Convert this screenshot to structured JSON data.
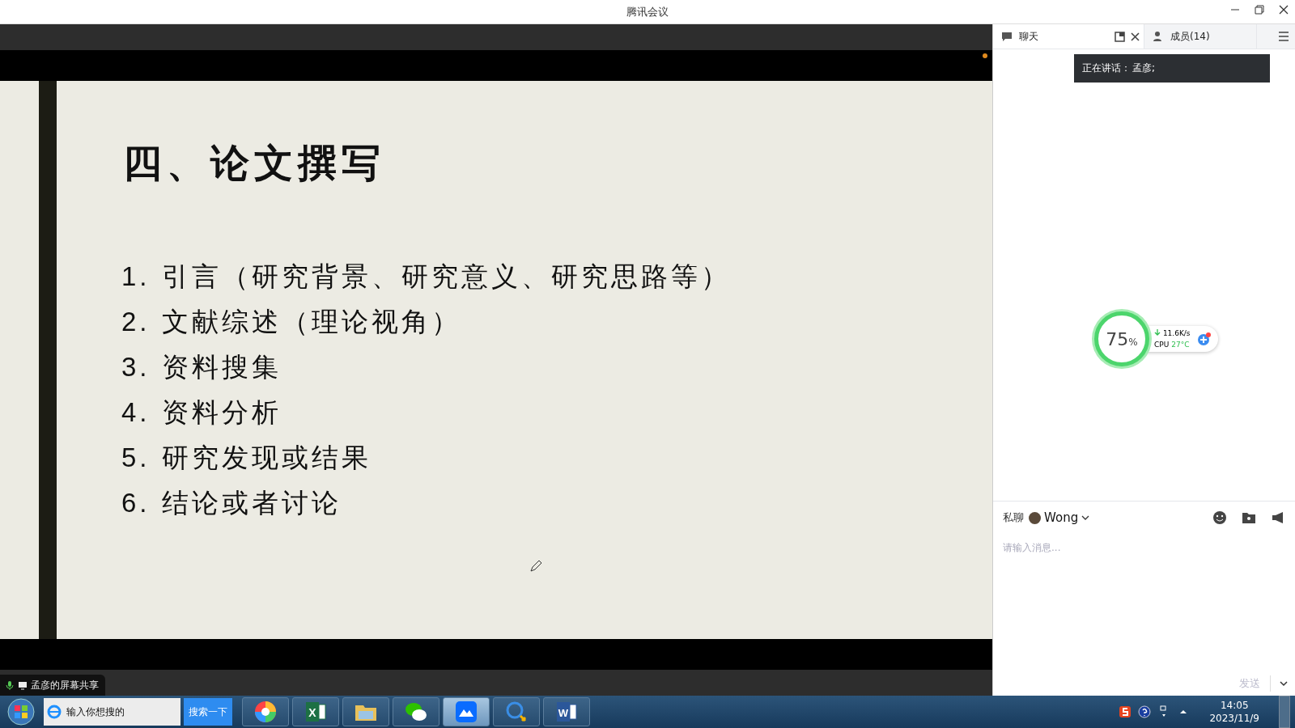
{
  "window": {
    "title": "腾讯会议"
  },
  "shared_screen": {
    "slide_title": "四、论文撰写",
    "items": [
      {
        "number": "1.",
        "text": "引言（研究背景、研究意义、研究思路等）"
      },
      {
        "number": "2.",
        "text": "文献综述（理论视角）"
      },
      {
        "number": "3.",
        "text": "资料搜集"
      },
      {
        "number": "4.",
        "text": "资料分析"
      },
      {
        "number": "5.",
        "text": "研究发现或结果"
      },
      {
        "number": "6.",
        "text": "结论或者讨论"
      }
    ],
    "share_label": "孟彦的屏幕共享"
  },
  "side_panel": {
    "tabs": [
      {
        "label": "聊天",
        "selected": true
      },
      {
        "label": "成员(14)",
        "selected": false
      }
    ],
    "speaking": {
      "label": "正在讲话：",
      "name": "孟彦;"
    },
    "monitor": {
      "percent": "75",
      "unit": "%",
      "speed": "11.6K/s",
      "cpu_label": "CPU",
      "temperature": "27°C"
    },
    "chat": {
      "scope": "私聊",
      "recipient": "Wong",
      "placeholder": "请输入消息...",
      "send": "发送"
    }
  },
  "taskbar": {
    "search_value": "输入你想搜的",
    "search_button": "搜索一下",
    "apps": [
      {
        "kind": "pinwheel",
        "selected": false
      },
      {
        "kind": "spreadsheet",
        "label": "X",
        "selected": false
      },
      {
        "kind": "folder",
        "selected": false
      },
      {
        "kind": "messenger",
        "selected": false
      },
      {
        "kind": "meeting",
        "selected": true
      },
      {
        "kind": "chat",
        "selected": false
      },
      {
        "kind": "document",
        "label": "W",
        "selected": false
      }
    ],
    "time": "14:05",
    "date": "2023/11/9"
  }
}
